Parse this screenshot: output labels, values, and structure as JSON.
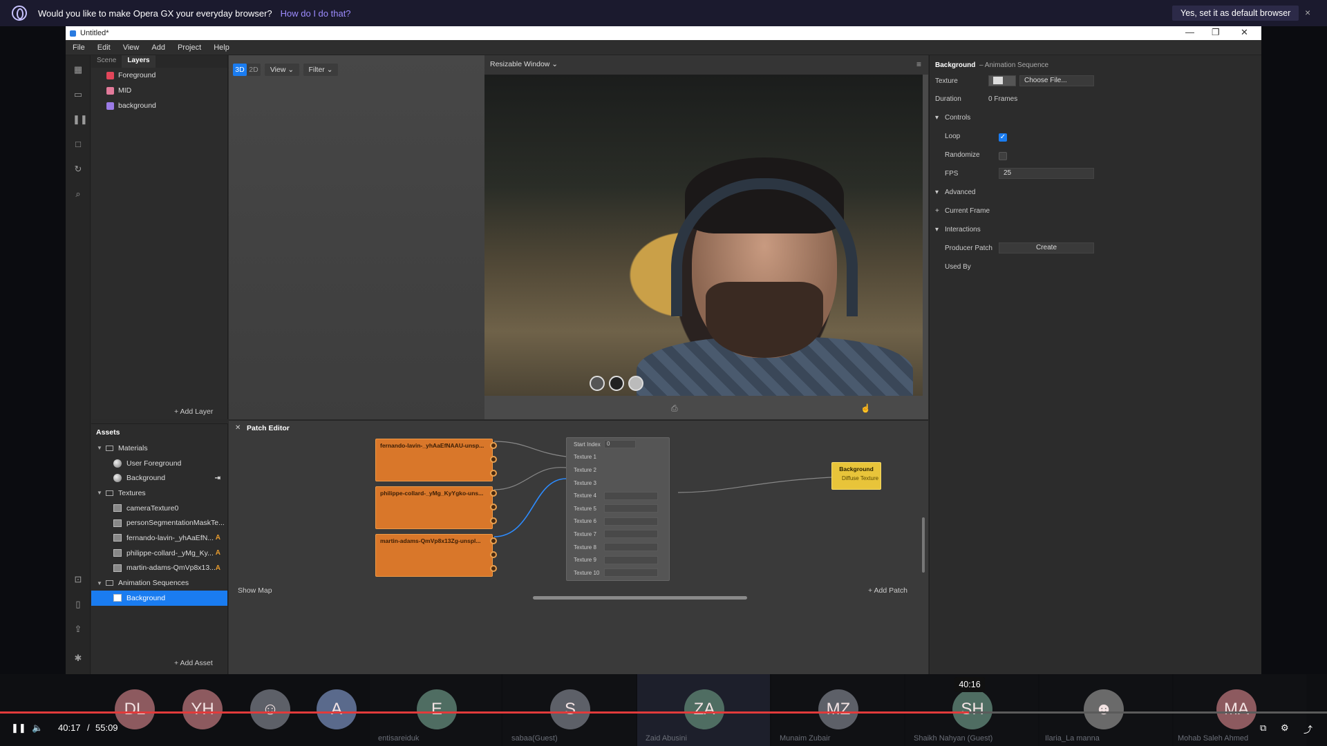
{
  "banner": {
    "message": "Would you like to make Opera GX your everyday browser?",
    "how_link": "How do I do that?",
    "set_default": "Yes, set it as default browser",
    "close": "×"
  },
  "window": {
    "title": "Untitled*",
    "controls": {
      "minimize": "—",
      "maximize": "❐",
      "close": "✕"
    }
  },
  "menu": [
    "File",
    "Edit",
    "View",
    "Add",
    "Project",
    "Help"
  ],
  "scene": {
    "tabs": [
      "Scene",
      "Layers"
    ],
    "layers": [
      {
        "label": "Foreground",
        "color": "#e2465a"
      },
      {
        "label": "MID",
        "color": "#e27a9a"
      },
      {
        "label": "background",
        "color": "#9b7be6"
      }
    ],
    "add_layer": "+ Add Layer"
  },
  "assets": {
    "title": "Assets",
    "materials_folder": "Materials",
    "materials": [
      "User Foreground",
      "Background"
    ],
    "textures_folder": "Textures",
    "textures": [
      {
        "label": "cameraTexture0",
        "badge": ""
      },
      {
        "label": "personSegmentationMaskTe...",
        "badge": ""
      },
      {
        "label": "fernando-lavin-_yhAaEfN...",
        "badge": "A"
      },
      {
        "label": "philippe-collard-_yMg_Ky...",
        "badge": "A"
      },
      {
        "label": "martin-adams-QmVp8x13...",
        "badge": "A"
      }
    ],
    "sequences_folder": "Animation Sequences",
    "sequences": [
      "Background"
    ],
    "add_asset": "+ Add Asset"
  },
  "viewport": {
    "mode_3d": "3D",
    "mode_2d": "2D",
    "view_menu": "View",
    "filter_menu": "Filter",
    "simulator": "Resizable Window"
  },
  "patch_editor": {
    "title": "Patch Editor",
    "texture_nodes": [
      "fernando-lavin-_yhAaEfNAAU-unsp...",
      "philippe-collard-_yMg_KyYgko-uns...",
      "martin-adams-QmVp8x13Zg-unspl..."
    ],
    "sequence_start_index_label": "Start Index",
    "sequence_start_index_value": "0",
    "sequence_inputs": [
      "Texture 1",
      "Texture 2",
      "Texture 3",
      "Texture 4",
      "Texture 5",
      "Texture 6",
      "Texture 7",
      "Texture 8",
      "Texture 9",
      "Texture 10"
    ],
    "material_node_title": "Background",
    "material_node_port": "Diffuse Texture",
    "show_map": "Show Map",
    "add_patch": "+ Add Patch"
  },
  "inspector": {
    "title": "Background",
    "subtitle": "– Animation Sequence",
    "texture_label": "Texture",
    "choose_file": "Choose File...",
    "duration_label": "Duration",
    "duration_value": "0 Frames",
    "controls_section": "Controls",
    "loop_label": "Loop",
    "loop_checked": true,
    "randomize_label": "Randomize",
    "randomize_checked": false,
    "fps_label": "FPS",
    "fps_value": "25",
    "advanced_section": "Advanced",
    "current_frame_section": "Current Frame",
    "interactions_section": "Interactions",
    "producer_patch_label": "Producer Patch",
    "create_button": "Create",
    "used_by_label": "Used By"
  },
  "call": {
    "participants": [
      {
        "initials": "DL",
        "name": "",
        "color": "#8d5a5f"
      },
      {
        "initials": "YH",
        "name": "",
        "color": "#8d5a5f"
      },
      {
        "initials": "",
        "name": "",
        "color": "#5d6068"
      },
      {
        "initials": "A",
        "name": "",
        "color": "#5a6a8c"
      },
      {
        "initials": "E",
        "name": "entisareiduk",
        "color": "#4f6d62"
      },
      {
        "initials": "S",
        "name": "sabaa(Guest)",
        "color": "#5d6068"
      },
      {
        "initials": "ZA",
        "name": "Zaid Abusini",
        "color": "#4f6d62"
      },
      {
        "initials": "MZ",
        "name": "Munaim Zubair",
        "color": "#5d6068"
      },
      {
        "initials": "SH",
        "name": "Shaikh Nahyan (Guest)",
        "color": "#4f6d62"
      },
      {
        "initials": "",
        "name": "Ilaria_La manna",
        "color": "#6a6a6a"
      },
      {
        "initials": "MA",
        "name": "Mohab   Saleh Ahmed",
        "color": "#8d5a5f"
      }
    ],
    "hover_time": "40:16",
    "current_time": "40:17",
    "separator": "/",
    "total_time": "55:09",
    "progress": 0.73
  }
}
